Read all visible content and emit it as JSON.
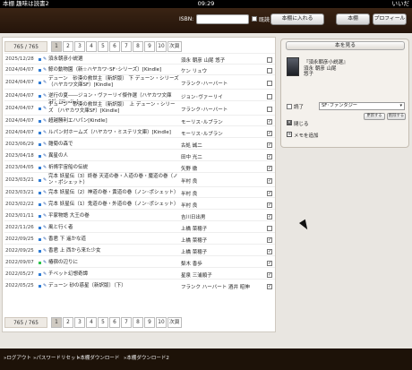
{
  "status": {
    "left": "本棚 趣味は読書2",
    "time": "09:29",
    "right": "いいだ"
  },
  "header": {
    "isbn_label": "ISBN:",
    "isbn_value": "",
    "read_label": "既読",
    "add_button": "本棚に入れる",
    "shelf_button": "本棚",
    "profile_button": "プロフィール"
  },
  "pager": {
    "count": "765 / 765",
    "pages": [
      "1",
      "2",
      "3",
      "4",
      "5",
      "6",
      "7",
      "8",
      "9",
      "10",
      "次頁"
    ],
    "active": "1"
  },
  "rows": [
    {
      "date": "2025/12/28",
      "dot": "#2e7cd6",
      "title": "須永朝彦小説選",
      "author": "須永 朝彦 山尾 悠子",
      "checked": false
    },
    {
      "date": "2024/04/07",
      "dot": "#2e7cd6",
      "title": "鯨の動物園（新☆ハヤカワ･SF･シリーズ）[Kindle]",
      "author": "ケン リュウ",
      "checked": false
    },
    {
      "date": "2024/04/07",
      "dot": "#2e7cd6",
      "title": "デューン　砂漠の救世主〔新訳版〕 下 デューン・シリーズ （ハヤカワ文庫SF）[Kindle]",
      "author": "フランク･ハーバート",
      "checked": false
    },
    {
      "date": "2024/04/07",
      "dot": "#2e7cd6",
      "title": "逆行の夏――ジョン・ヴァーリイ傑作選（ハヤカワ文庫SF）[Kindle]",
      "author": "ジョン･ヴァーリイ",
      "checked": false
    },
    {
      "date": "2024/04/07",
      "dot": "#2e7cd6",
      "title": "デューン　砂漠の救世主〔新訳版〕　上 デューン・シリーズ （ハヤカワ文庫SF）[Kindle]",
      "author": "フランク･ハーバート",
      "checked": false
    },
    {
      "date": "2024/04/07",
      "dot": "#2e7cd6",
      "title": "超越勝利エハパン[Kindle]",
      "author": "モーリス･ルブラン",
      "checked": true
    },
    {
      "date": "2024/04/07",
      "dot": "#2e7cd6",
      "title": "ルパン対ホームズ（ハヤカワ・ミステリ文庫）[Kindle]",
      "author": "モーリス･ルブラン",
      "checked": true
    },
    {
      "date": "2023/06/29",
      "dot": "#2e7cd6",
      "title": "雛菊の森で",
      "author": "古処 誠二",
      "checked": true
    },
    {
      "date": "2023/04/18",
      "dot": "#2e7cd6",
      "title": "異星の人",
      "author": "田中 光二",
      "checked": true
    },
    {
      "date": "2023/04/05",
      "dot": "#2e7cd6",
      "title": "祈祷宇宙船の伝説",
      "author": "矢野 徹",
      "checked": true
    },
    {
      "date": "2023/03/21",
      "dot": "#2e7cd6",
      "title": "完本 妖星伝（3）終巻 天道の巻・人道の巻・魔道の巻（ノン・ポシェット）",
      "author": "半村 良",
      "checked": true
    },
    {
      "date": "2023/03/21",
      "dot": "#2e7cd6",
      "title": "完本 妖星伝（2）神道の巻・黄道の巻（ノン･ポシェット）",
      "author": "半村 良",
      "checked": true
    },
    {
      "date": "2023/02/22",
      "dot": "#2e7cd6",
      "title": "完本 妖星伝（1）鬼道の巻・外道の巻（ノン･ポシェット）",
      "author": "半村 良",
      "checked": true
    },
    {
      "date": "2023/01/11",
      "dot": "#2e7cd6",
      "title": "平家物語 大王の巻",
      "author": "吉川日出男",
      "checked": true
    },
    {
      "date": "2022/11/26",
      "dot": "#2e7cd6",
      "title": "風と行く者",
      "author": "上橋 菜穂子",
      "checked": false
    },
    {
      "date": "2022/09/25",
      "dot": "#2e7cd6",
      "title": "香君 下 遥かな道",
      "author": "上橋 菜穂子",
      "checked": true
    },
    {
      "date": "2022/09/25",
      "dot": "#2e7cd6",
      "title": "香君 上 西から来た少女",
      "author": "上橋 菜穂子",
      "checked": true
    },
    {
      "date": "2022/09/07",
      "dot": "#2ec44e",
      "title": "椿宿の辺りに",
      "author": "梨木 香歩",
      "checked": true
    },
    {
      "date": "2022/05/27",
      "dot": "#2e7cd6",
      "title": "チベット幻想奇譚",
      "author": "星泉 三浦順子",
      "checked": true
    },
    {
      "date": "2022/05/25",
      "dot": "#2e7cd6",
      "title": "デューン 砂の惑星〔新訳版〕（下）",
      "author": "フランク ハーバート 酒井 昭伸",
      "checked": true
    }
  ],
  "side": {
    "button": "本を見る",
    "title": "『須永朝彦小説選』",
    "author": "須永 朝彦 山尾 悠子",
    "done_label": "読了",
    "genre": "SF･ファンタジー",
    "update_button": "更新する",
    "delete_button": "削除する",
    "close_label": "閉じる",
    "memo_label": "メモを追加"
  },
  "footer": {
    "logout": "»ログアウト",
    "reset": "»パスワードリセット",
    "download": "»本棚ダウンロード",
    "download2": "»本棚ダウンロード2"
  }
}
